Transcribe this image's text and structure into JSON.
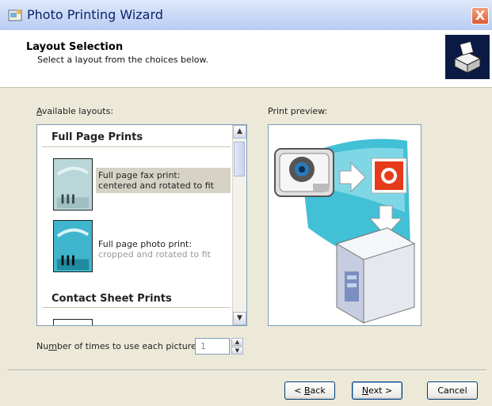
{
  "window": {
    "title": "Photo Printing Wizard",
    "close_glyph": "X"
  },
  "header": {
    "title": "Layout Selection",
    "subtitle": "Select a layout from the choices below.",
    "art_icon": "printer-wizard-icon"
  },
  "layouts": {
    "label_prefix": "",
    "label_access": "A",
    "label_rest": "vailable layouts:",
    "groups": [
      {
        "name": "Full Page Prints"
      },
      {
        "name": "Contact Sheet Prints"
      }
    ],
    "items": [
      {
        "line1": "Full page fax print:",
        "line2": "centered and rotated to fit",
        "selected": true
      },
      {
        "line1": "Full page photo print:",
        "line2": "cropped and rotated to fit",
        "selected": false
      }
    ],
    "scroll_up": "▲",
    "scroll_down": "▼"
  },
  "preview": {
    "label": "Print preview:"
  },
  "copies": {
    "label_pre": "Nu",
    "label_access": "m",
    "label_post": "ber of times to use each picture:",
    "value": "1",
    "up": "▲",
    "down": "▼"
  },
  "buttons": {
    "back_pre": "< ",
    "back_access": "B",
    "back_post": "ack",
    "next_access": "N",
    "next_post": "ext >",
    "cancel": "Cancel"
  },
  "colors": {
    "selection": "#d6d3c6",
    "title_text": "#0a246a",
    "close": "#de5c34"
  }
}
